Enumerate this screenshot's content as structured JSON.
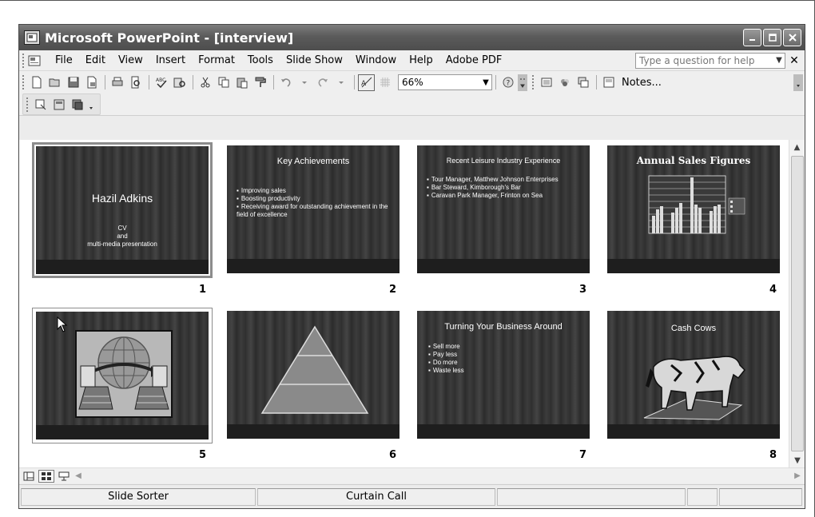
{
  "window": {
    "title": "Microsoft PowerPoint - [interview]"
  },
  "menu": {
    "items": [
      "File",
      "Edit",
      "View",
      "Insert",
      "Format",
      "Tools",
      "Slide Show",
      "Window",
      "Help",
      "Adobe PDF"
    ],
    "help_placeholder": "Type a question for help"
  },
  "toolbar": {
    "zoom": "66%",
    "notes_label": "Notes..."
  },
  "slides": [
    {
      "number": "1",
      "title": "Hazil Adkins",
      "subtitle_lines": [
        "CV",
        "and",
        "multi-media presentation"
      ]
    },
    {
      "number": "2",
      "title": "Key Achievements",
      "bullets": [
        "Improving sales",
        "Boosting productivity",
        "Receiving award for outstanding achievement in the field of excellence"
      ]
    },
    {
      "number": "3",
      "title": "Recent Leisure Industry Experience",
      "bullets": [
        "Tour Manager, Matthew Johnson Enterprises",
        "Bar Steward, Kimborough's Bar",
        "Caravan Park Manager, Frinton on Sea"
      ]
    },
    {
      "number": "4",
      "title": "Annual Sales Figures"
    },
    {
      "number": "5"
    },
    {
      "number": "6"
    },
    {
      "number": "7",
      "title": "Turning Your Business Around",
      "bullets": [
        "Sell more",
        "Pay less",
        "Do more",
        "Waste less"
      ]
    },
    {
      "number": "8",
      "title": "Cash Cows"
    }
  ],
  "status": {
    "view": "Slide Sorter",
    "design": "Curtain Call"
  },
  "colors": {
    "titlebar": "#5b5b5b",
    "slide_background": "#2a2a2a",
    "pyramid": "#8a8a8a"
  }
}
